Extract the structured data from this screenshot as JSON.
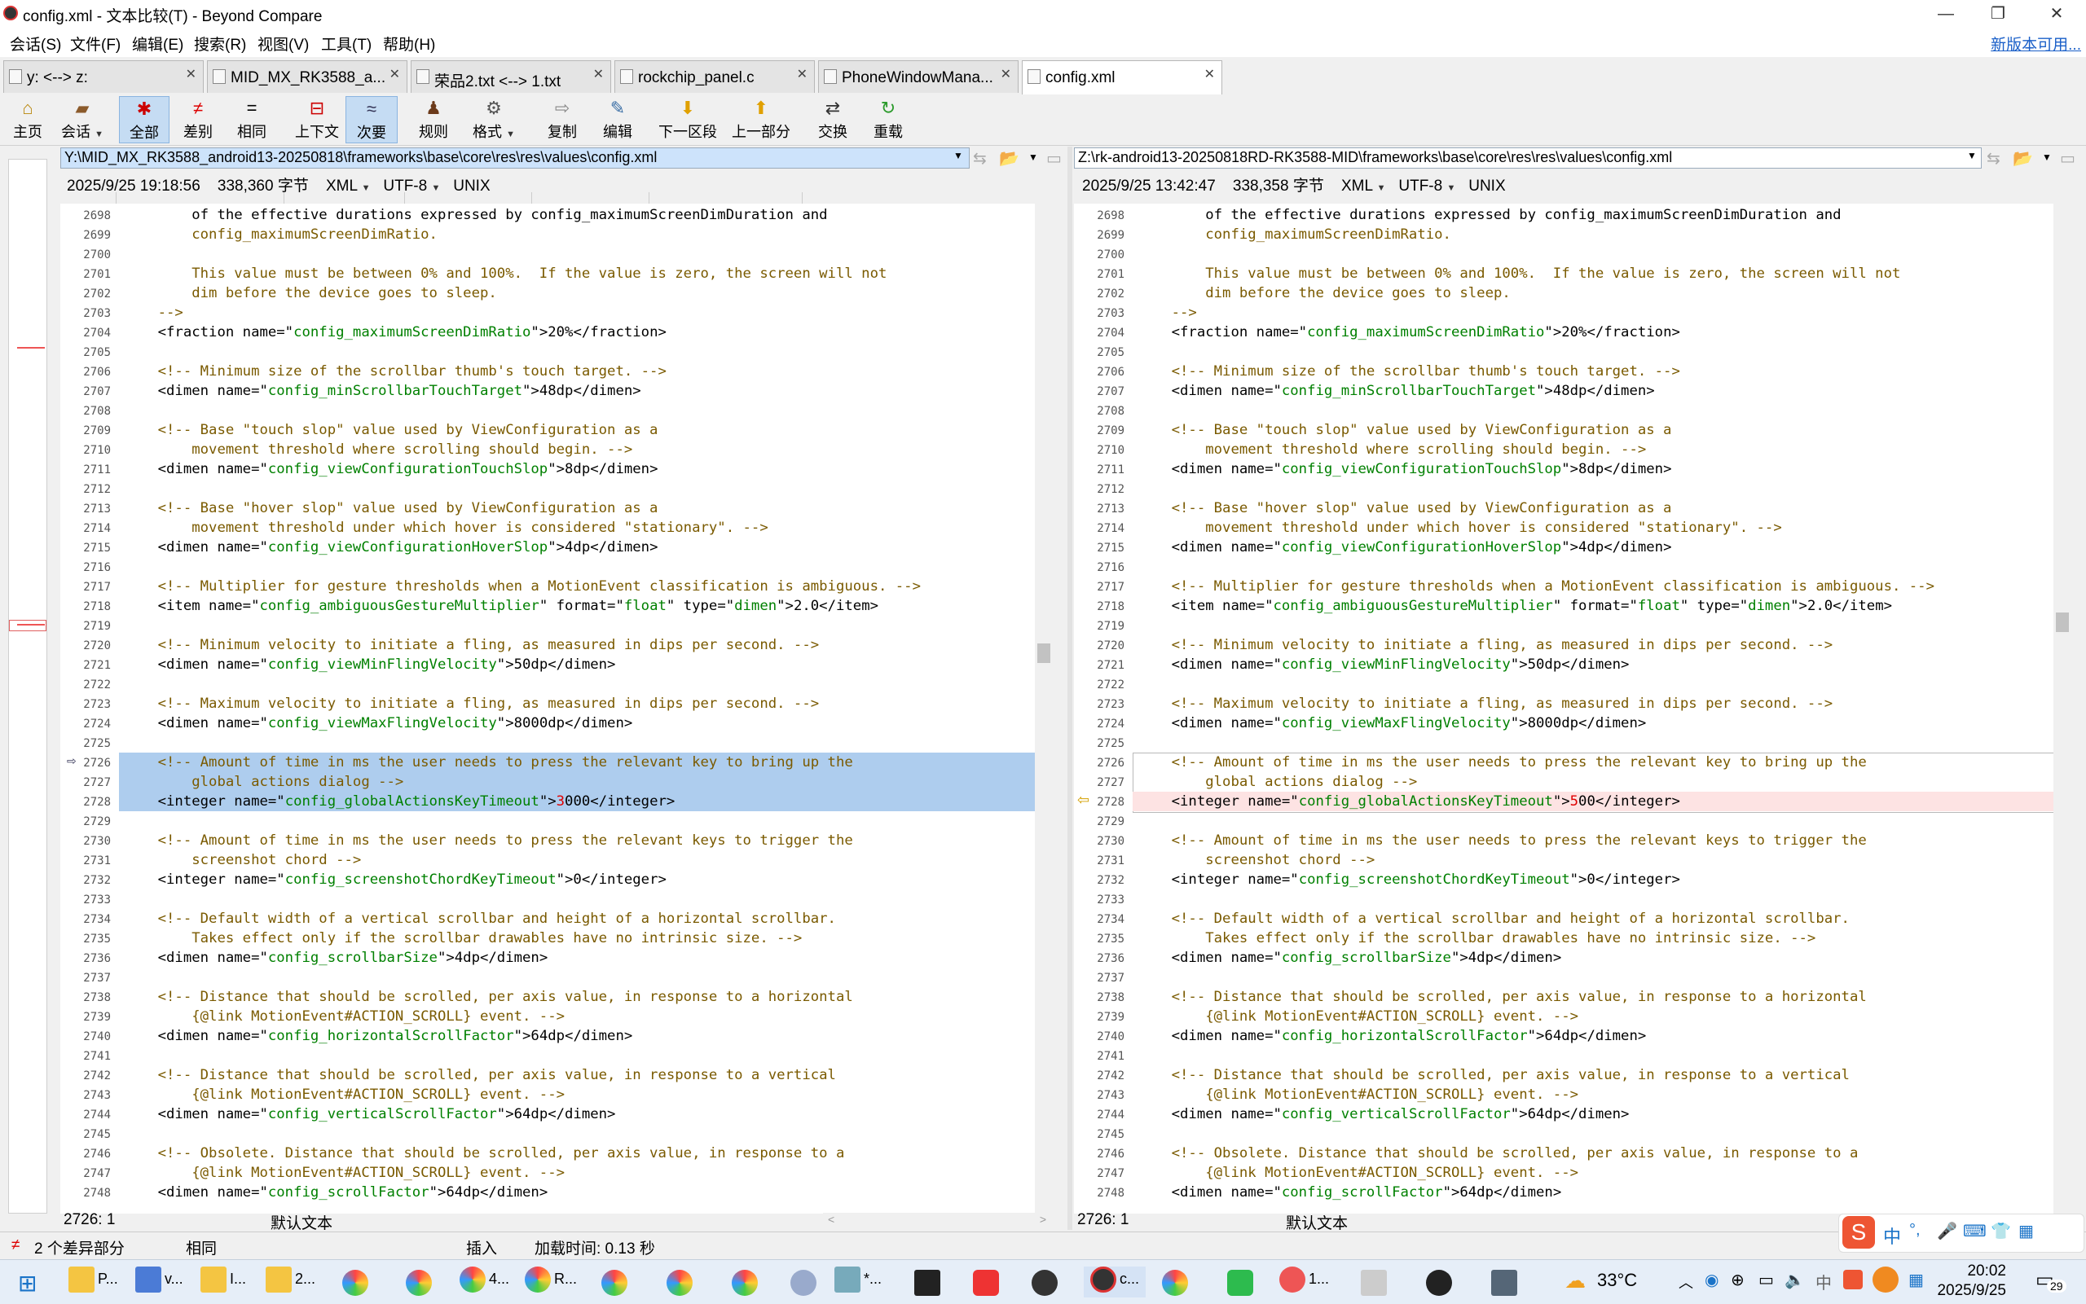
{
  "window": {
    "title": "config.xml - 文本比较(T) - Beyond Compare",
    "minimize": "—",
    "maximize": "❐",
    "close": "✕"
  },
  "menu": {
    "items": [
      "会话(S)",
      "文件(F)",
      "编辑(E)",
      "搜索(R)",
      "视图(V)",
      "工具(T)",
      "帮助(H)"
    ],
    "new_version": "新版本可用..."
  },
  "tabs": [
    {
      "label": "y: <--> z:"
    },
    {
      "label": "MID_MX_RK3588_a..."
    },
    {
      "label": "荣品2.txt <--> 1.txt"
    },
    {
      "label": "rockchip_panel.c"
    },
    {
      "label": "PhoneWindowMana..."
    },
    {
      "label": "config.xml"
    }
  ],
  "toolbar": [
    {
      "label": "主页",
      "icon": "home-icon"
    },
    {
      "label": "会话",
      "icon": "session-icon"
    },
    {
      "label": "全部",
      "icon": "all-icon"
    },
    {
      "label": "差别",
      "icon": "diff-icon"
    },
    {
      "label": "相同",
      "icon": "same-icon"
    },
    {
      "label": "上下文",
      "icon": "context-icon"
    },
    {
      "label": "次要",
      "icon": "minor-icon"
    },
    {
      "label": "规则",
      "icon": "rules-icon"
    },
    {
      "label": "格式",
      "icon": "format-icon"
    },
    {
      "label": "复制",
      "icon": "copy-icon"
    },
    {
      "label": "编辑",
      "icon": "edit-icon"
    },
    {
      "label": "下一区段",
      "icon": "next-section-icon"
    },
    {
      "label": "上一部分",
      "icon": "prev-section-icon"
    },
    {
      "label": "交换",
      "icon": "swap-icon"
    },
    {
      "label": "重载",
      "icon": "reload-icon"
    }
  ],
  "left": {
    "path": "Y:\\MID_MX_RK3588_android13-20250818\\frameworks\\base\\core\\res\\res\\values\\config.xml",
    "date": "2025/9/25 19:18:56",
    "size": "338,360 字节",
    "format": "XML",
    "encoding": "UTF-8",
    "eol": "UNIX",
    "cursor": "2726: 1",
    "mode": "默认文本"
  },
  "right": {
    "path": "Z:\\rk-android13-20250818RD-RK3588-MID\\frameworks\\base\\core\\res\\res\\values\\config.xml",
    "date": "2025/9/25 13:42:47",
    "size": "338,358 字节",
    "format": "XML",
    "encoding": "UTF-8",
    "eol": "UNIX",
    "cursor": "2726: 1",
    "mode": "默认文本"
  },
  "line_numbers": [
    "2698",
    "2699",
    "2700",
    "2701",
    "2702",
    "2703",
    "2704",
    "2705",
    "2706",
    "2707",
    "2708",
    "2709",
    "2710",
    "2711",
    "2712",
    "2713",
    "2714",
    "2715",
    "2716",
    "2717",
    "2718",
    "2719",
    "2720",
    "2721",
    "2722",
    "2723",
    "2724",
    "2725",
    "2726",
    "2727",
    "2728",
    "2729",
    "2730",
    "2731",
    "2732",
    "2733",
    "2734",
    "2735",
    "2736",
    "2737",
    "2738",
    "2739",
    "2740",
    "2741",
    "2742",
    "2743",
    "2744",
    "2745",
    "2746",
    "2747",
    "2748"
  ],
  "code_left": [
    "        of the effective durations expressed by config_maximumScreenDimDuration and",
    "        config_maximumScreenDimRatio.",
    "",
    "        This value must be between 0% and 100%.  If the value is zero, the screen will not",
    "        dim before the device goes to sleep.",
    "    -->",
    "    <fraction name=\"config_maximumScreenDimRatio\">20%</fraction>",
    "",
    "    <!-- Minimum size of the scrollbar thumb's touch target. -->",
    "    <dimen name=\"config_minScrollbarTouchTarget\">48dp</dimen>",
    "",
    "    <!-- Base \"touch slop\" value used by ViewConfiguration as a",
    "        movement threshold where scrolling should begin. -->",
    "    <dimen name=\"config_viewConfigurationTouchSlop\">8dp</dimen>",
    "",
    "    <!-- Base \"hover slop\" value used by ViewConfiguration as a",
    "        movement threshold under which hover is considered \"stationary\". -->",
    "    <dimen name=\"config_viewConfigurationHoverSlop\">4dp</dimen>",
    "",
    "    <!-- Multiplier for gesture thresholds when a MotionEvent classification is ambiguous. -->",
    "    <item name=\"config_ambiguousGestureMultiplier\" format=\"float\" type=\"dimen\">2.0</item>",
    "",
    "    <!-- Minimum velocity to initiate a fling, as measured in dips per second. -->",
    "    <dimen name=\"config_viewMinFlingVelocity\">50dp</dimen>",
    "",
    "    <!-- Maximum velocity to initiate a fling, as measured in dips per second. -->",
    "    <dimen name=\"config_viewMaxFlingVelocity\">8000dp</dimen>",
    "",
    "    <!-- Amount of time in ms the user needs to press the relevant key to bring up the",
    "        global actions dialog -->",
    "    <integer name=\"config_globalActionsKeyTimeout\">3000</integer>",
    "",
    "    <!-- Amount of time in ms the user needs to press the relevant keys to trigger the",
    "        screenshot chord -->",
    "    <integer name=\"config_screenshotChordKeyTimeout\">0</integer>",
    "",
    "    <!-- Default width of a vertical scrollbar and height of a horizontal scrollbar.",
    "        Takes effect only if the scrollbar drawables have no intrinsic size. -->",
    "    <dimen name=\"config_scrollbarSize\">4dp</dimen>",
    "",
    "    <!-- Distance that should be scrolled, per axis value, in response to a horizontal",
    "        {@link MotionEvent#ACTION_SCROLL} event. -->",
    "    <dimen name=\"config_horizontalScrollFactor\">64dp</dimen>",
    "",
    "    <!-- Distance that should be scrolled, per axis value, in response to a vertical",
    "        {@link MotionEvent#ACTION_SCROLL} event. -->",
    "    <dimen name=\"config_verticalScrollFactor\">64dp</dimen>",
    "",
    "    <!-- Obsolete. Distance that should be scrolled, per axis value, in response to a",
    "        {@link MotionEvent#ACTION_SCROLL} event. -->",
    "    <dimen name=\"config_scrollFactor\">64dp</dimen>"
  ],
  "code_right": [
    "        of the effective durations expressed by config_maximumScreenDimDuration and",
    "        config_maximumScreenDimRatio.",
    "",
    "        This value must be between 0% and 100%.  If the value is zero, the screen will not",
    "        dim before the device goes to sleep.",
    "    -->",
    "    <fraction name=\"config_maximumScreenDimRatio\">20%</fraction>",
    "",
    "    <!-- Minimum size of the scrollbar thumb's touch target. -->",
    "    <dimen name=\"config_minScrollbarTouchTarget\">48dp</dimen>",
    "",
    "    <!-- Base \"touch slop\" value used by ViewConfiguration as a",
    "        movement threshold where scrolling should begin. -->",
    "    <dimen name=\"config_viewConfigurationTouchSlop\">8dp</dimen>",
    "",
    "    <!-- Base \"hover slop\" value used by ViewConfiguration as a",
    "        movement threshold under which hover is considered \"stationary\". -->",
    "    <dimen name=\"config_viewConfigurationHoverSlop\">4dp</dimen>",
    "",
    "    <!-- Multiplier for gesture thresholds when a MotionEvent classification is ambiguous. -->",
    "    <item name=\"config_ambiguousGestureMultiplier\" format=\"float\" type=\"dimen\">2.0</item>",
    "",
    "    <!-- Minimum velocity to initiate a fling, as measured in dips per second. -->",
    "    <dimen name=\"config_viewMinFlingVelocity\">50dp</dimen>",
    "",
    "    <!-- Maximum velocity to initiate a fling, as measured in dips per second. -->",
    "    <dimen name=\"config_viewMaxFlingVelocity\">8000dp</dimen>",
    "",
    "    <!-- Amount of time in ms the user needs to press the relevant key to bring up the",
    "        global actions dialog -->",
    "    <integer name=\"config_globalActionsKeyTimeout\">500</integer>",
    "",
    "    <!-- Amount of time in ms the user needs to press the relevant keys to trigger the",
    "        screenshot chord -->",
    "    <integer name=\"config_screenshotChordKeyTimeout\">0</integer>",
    "",
    "    <!-- Default width of a vertical scrollbar and height of a horizontal scrollbar.",
    "        Takes effect only if the scrollbar drawables have no intrinsic size. -->",
    "    <dimen name=\"config_scrollbarSize\">4dp</dimen>",
    "",
    "    <!-- Distance that should be scrolled, per axis value, in response to a horizontal",
    "        {@link MotionEvent#ACTION_SCROLL} event. -->",
    "    <dimen name=\"config_horizontalScrollFactor\">64dp</dimen>",
    "",
    "    <!-- Distance that should be scrolled, per axis value, in response to a vertical",
    "        {@link MotionEvent#ACTION_SCROLL} event. -->",
    "    <dimen name=\"config_verticalScrollFactor\">64dp</dimen>",
    "",
    "    <!-- Obsolete. Distance that should be scrolled, per axis value, in response to a",
    "        {@link MotionEvent#ACTION_SCROLL} event. -->",
    "    <dimen name=\"config_scrollFactor\">64dp</dimen>"
  ],
  "status": {
    "diff_count": "2 个差异部分",
    "same": "相同",
    "insert": "插入",
    "load_time": "加载时间: 0.13 秒"
  },
  "taskbar": {
    "apps": [
      "P...",
      "v...",
      "I...",
      "2...",
      "4...",
      "R...",
      "*...",
      "c...",
      "1..."
    ],
    "weather": "33°C",
    "ime": "中",
    "time": "20:02",
    "date": "2025/9/25",
    "notif": "29"
  },
  "colors": {
    "diff_block": "#aecdee",
    "diff_line": "#fde3e3",
    "comment": "#7a5a00",
    "attr": "#008000",
    "changed": "#e00000"
  }
}
